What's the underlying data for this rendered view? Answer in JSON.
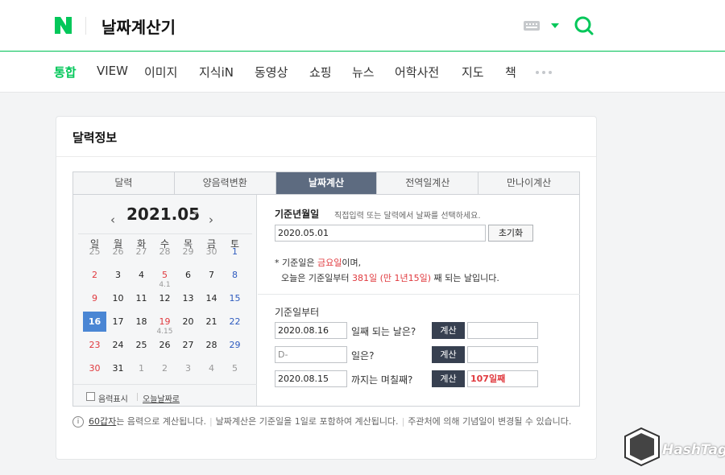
{
  "header": {
    "logo": "N",
    "search_value": "날짜계산기",
    "brand_color": "#03c75a"
  },
  "tabs": [
    "통합",
    "VIEW",
    "이미지",
    "지식iN",
    "동영상",
    "쇼핑",
    "뉴스",
    "어학사전",
    "지도",
    "책"
  ],
  "card": {
    "title": "달력정보",
    "calc_tabs": [
      "달력",
      "양음력변환",
      "날짜계산",
      "전역일계산",
      "만나이계산"
    ],
    "active_tab": "날짜계산"
  },
  "calendar": {
    "month_label": "2021.05",
    "weekdays": [
      "일",
      "월",
      "화",
      "수",
      "목",
      "금",
      "토"
    ],
    "weeks": [
      [
        "25",
        "26",
        "27",
        "28",
        "29",
        "30",
        "1"
      ],
      [
        "2",
        "3",
        "4",
        "5",
        "6",
        "7",
        "8"
      ],
      [
        "9",
        "10",
        "11",
        "12",
        "13",
        "14",
        "15"
      ],
      [
        "16",
        "17",
        "18",
        "19",
        "20",
        "21",
        "22"
      ],
      [
        "23",
        "24",
        "25",
        "26",
        "27",
        "28",
        "29"
      ],
      [
        "30",
        "31",
        "1",
        "2",
        "3",
        "4",
        "5"
      ]
    ],
    "lunar_notes": {
      "w2d3": "4.1",
      "w4d3": "4.15"
    },
    "today": "16",
    "lunar_checkbox_label": "음력표시",
    "today_link": "오늘날짜로"
  },
  "calc": {
    "base_label": "기준년월일",
    "base_hint": "직접입력 또는 달력에서 날짜를 선택하세요.",
    "base_value": "2020.05.01",
    "reset_button": "초기화",
    "note1_a": "* 기준일은 ",
    "note1_b": "금요일",
    "note1_c": "이며,",
    "note2_a": "오늘은 기준일부터 ",
    "note2_b": "381일 (만 1년15일)",
    "note2_c": " 째 되는 날입니다.",
    "from_label": "기준일부터",
    "row1_input": "2020.08.16",
    "row1_text": "일째 되는 날은?",
    "row2_input": "D-",
    "row2_text": "일은?",
    "row3_input": "2020.08.15",
    "row3_text": "까지는 며칠째?",
    "calc_button": "계산",
    "row3_result": "107일째"
  },
  "info": {
    "icon": "i",
    "link": "60갑자",
    "text1": "는 음력으로 계산됩니다.",
    "text2": "날짜계산은 기준일을 1일로 포함하여 계산됩니다.",
    "text3": "주관처에 의해 기념일이 변경될 수 있습니다."
  },
  "watermark": {
    "badge": "Hash Tag",
    "text": "HashTag"
  }
}
